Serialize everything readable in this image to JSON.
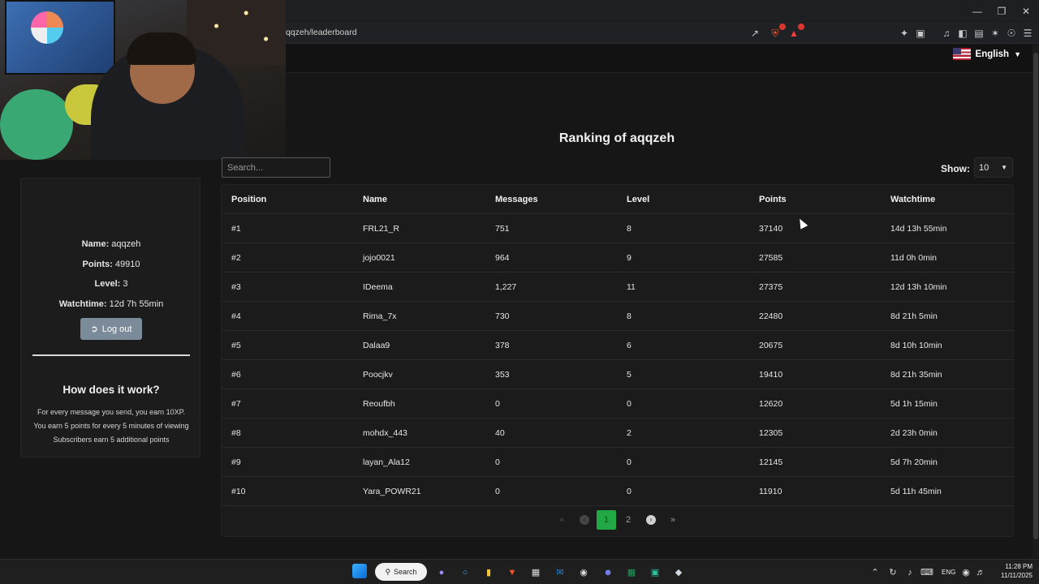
{
  "browser": {
    "url": "qqzeh/leaderboard"
  },
  "header": {
    "language": "English"
  },
  "sidebar": {
    "name_label": "Name:",
    "name_value": "aqqzeh",
    "points_label": "Points:",
    "points_value": "49910",
    "level_label": "Level:",
    "level_value": "3",
    "watchtime_label": "Watchtime:",
    "watchtime_value": "12d 7h 55min",
    "logout_label": "Log out",
    "how_title": "How does it work?",
    "how_lines": [
      "For every message you send, you earn 10XP.",
      "You earn 5 points for every 5 minutes of viewing",
      "Subscribers earn 5 additional points"
    ]
  },
  "main": {
    "title": "Ranking of aqqzeh",
    "search_placeholder": "Search...",
    "show_label": "Show:",
    "show_value": "10"
  },
  "table": {
    "headers": [
      "Position",
      "Name",
      "Messages",
      "Level",
      "Points",
      "Watchtime"
    ],
    "rows": [
      [
        "#1",
        "FRL21_R",
        "751",
        "8",
        "37140",
        "14d 13h 55min"
      ],
      [
        "#2",
        "jojo0021",
        "964",
        "9",
        "27585",
        "11d 0h 0min"
      ],
      [
        "#3",
        "IDeema",
        "1,227",
        "11",
        "27375",
        "12d 13h 10min"
      ],
      [
        "#4",
        "Rima_7x",
        "730",
        "8",
        "22480",
        "8d 21h 5min"
      ],
      [
        "#5",
        "Dalaa9",
        "378",
        "6",
        "20675",
        "8d 10h 10min"
      ],
      [
        "#6",
        "Poocjkv",
        "353",
        "5",
        "19410",
        "8d 21h 35min"
      ],
      [
        "#7",
        "Reoufbh",
        "0",
        "0",
        "12620",
        "5d 1h 15min"
      ],
      [
        "#8",
        "mohdx_443",
        "40",
        "2",
        "12305",
        "2d 23h 0min"
      ],
      [
        "#9",
        "layan_Ala12",
        "0",
        "0",
        "12145",
        "5d 7h 20min"
      ],
      [
        "#10",
        "Yara_POWR21",
        "0",
        "0",
        "11910",
        "5d 11h 45min"
      ]
    ]
  },
  "pagination": {
    "first": "«",
    "prev": "‹",
    "pages": [
      "1",
      "2"
    ],
    "next": "›",
    "last": "»",
    "active_page": "1"
  },
  "taskbar": {
    "search_label": "Search",
    "language": "ENG",
    "time": "11:28 PM",
    "date": "11/11/2025"
  },
  "icons": {
    "brave": "brave-lion-icon",
    "rewards": "brave-rewards-icon",
    "windows": "windows-start-icon"
  },
  "colors": {
    "accent_active_page": "#22a845",
    "logout_button": "#7b8b9a",
    "background": "#161616"
  }
}
